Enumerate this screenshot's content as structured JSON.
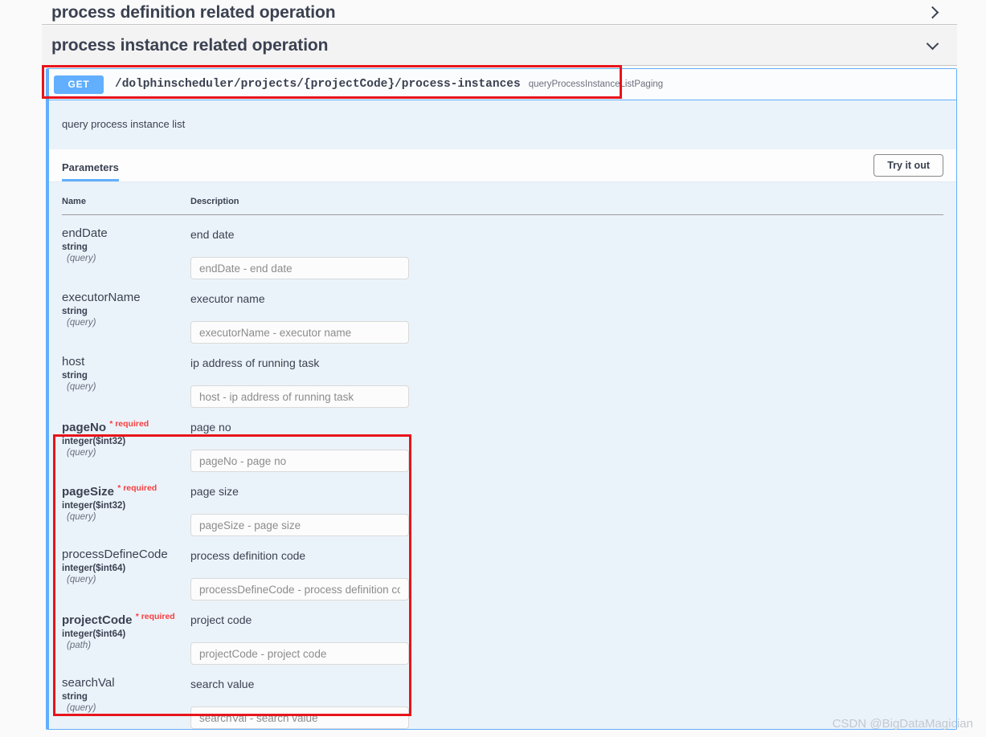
{
  "page": {
    "watermark": "CSDN @BigDataMagician",
    "accent_color": "#61affe",
    "required_color": "#f93e3e",
    "annotation_color": "#e8141c"
  },
  "tags": [
    {
      "title": "process definition related operation",
      "expanded": false,
      "chevron": "chevron-right-icon"
    },
    {
      "title": "process instance related operation",
      "expanded": true,
      "chevron": "chevron-down-icon"
    }
  ],
  "operation": {
    "method": "GET",
    "path": "/dolphinscheduler/projects/{projectCode}/process-instances",
    "operation_id": "queryProcessInstanceListPaging",
    "description": "query process instance list",
    "tabs": [
      {
        "label": "Parameters",
        "active": true
      }
    ],
    "try_it_out_label": "Try it out",
    "table_headers": {
      "name": "Name",
      "description": "Description"
    },
    "parameters": [
      {
        "name": "endDate",
        "required": false,
        "required_label": "",
        "type": "string",
        "in": "(query)",
        "description": "end date",
        "placeholder": "endDate - end date",
        "value": ""
      },
      {
        "name": "executorName",
        "required": false,
        "required_label": "",
        "type": "string",
        "in": "(query)",
        "description": "executor name",
        "placeholder": "executorName - executor name",
        "value": ""
      },
      {
        "name": "host",
        "required": false,
        "required_label": "",
        "type": "string",
        "in": "(query)",
        "description": "ip address of running task",
        "placeholder": "host - ip address of running task",
        "value": ""
      },
      {
        "name": "pageNo",
        "required": true,
        "required_label": "* required",
        "type": "integer($int32)",
        "in": "(query)",
        "description": "page no",
        "placeholder": "pageNo - page no",
        "value": ""
      },
      {
        "name": "pageSize",
        "required": true,
        "required_label": "* required",
        "type": "integer($int32)",
        "in": "(query)",
        "description": "page size",
        "placeholder": "pageSize - page size",
        "value": ""
      },
      {
        "name": "processDefineCode",
        "required": false,
        "required_label": "",
        "type": "integer($int64)",
        "in": "(query)",
        "description": "process definition code",
        "placeholder": "processDefineCode - process definition code",
        "value": ""
      },
      {
        "name": "projectCode",
        "required": true,
        "required_label": "* required",
        "type": "integer($int64)",
        "in": "(path)",
        "description": "project code",
        "placeholder": "projectCode - project code",
        "value": ""
      },
      {
        "name": "searchVal",
        "required": false,
        "required_label": "",
        "type": "string",
        "in": "(query)",
        "description": "search value",
        "placeholder": "searchVal - search value",
        "value": ""
      }
    ]
  }
}
